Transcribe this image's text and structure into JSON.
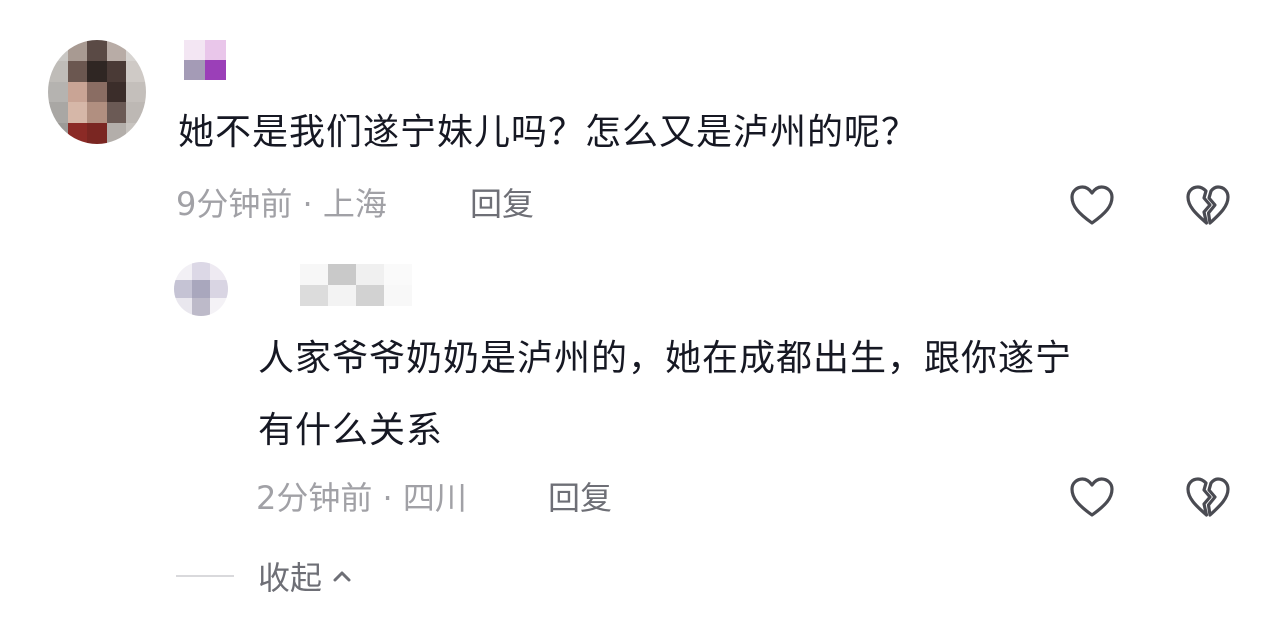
{
  "comment": {
    "text": "她不是我们遂宁妹儿吗？怎么又是泸州的呢？",
    "time_location": "9分钟前 · 上海",
    "reply_label": "回复"
  },
  "reply": {
    "text_line1": "人家爷爷奶奶是泸州的，她在成都出生，跟你遂宁",
    "text_line2": "有什么关系",
    "time_location": "2分钟前 · 四川",
    "reply_label": "回复"
  },
  "collapse": {
    "label": "收起"
  },
  "icons": {
    "like": "heart-outline-icon",
    "dislike": "broken-heart-icon",
    "collapse": "chevron-up-icon"
  },
  "colors": {
    "text": "#161823",
    "meta": "#a1a1a6",
    "action": "#6e6f76"
  }
}
